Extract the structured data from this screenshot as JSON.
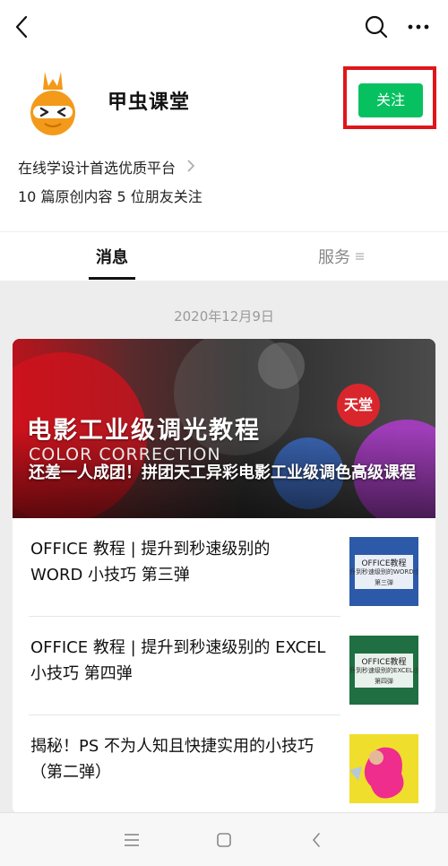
{
  "topbar": {
    "back_icon": "chevron-left-icon",
    "search_icon": "search-icon",
    "more_icon": "more-horizontal-icon"
  },
  "account": {
    "name": "甲虫课堂",
    "follow_label": "关注",
    "follow_color": "#07c160",
    "highlight_color": "#e0151b",
    "description": "在线学设计首选优质平台",
    "stats": "10 篇原创内容  5 位朋友关注"
  },
  "tabs": {
    "messages": "消息",
    "services": "服务"
  },
  "feed": {
    "date": "2020年12月9日",
    "banner": {
      "title": "电影工业级调光教程",
      "subtitle": "COLOR CORRECTION",
      "seal": "天堂",
      "caption": "还差一人成团！拼团天工异彩电影工业级调色高级课程"
    },
    "articles": [
      {
        "title": "OFFICE 教程 | 提升到秒速级别的 WORD 小技巧 第三弹",
        "thumb_line1": "OFFICE教程",
        "thumb_line2": "升到秒速级别的WORD小技",
        "thumb_line3": "第三弹"
      },
      {
        "title": "OFFICE 教程 | 提升到秒速级别的 EXCEL 小技巧 第四弹",
        "thumb_line1": "OFFICE教程",
        "thumb_line2": "升到秒速级别的EXCEL小技",
        "thumb_line3": "第四弹"
      },
      {
        "title": "揭秘！PS 不为人知且快捷实用的小技巧（第二弹）"
      }
    ]
  },
  "navbar": {
    "menu_icon": "menu-icon",
    "home_icon": "home-square-icon",
    "back_icon": "nav-back-icon"
  }
}
